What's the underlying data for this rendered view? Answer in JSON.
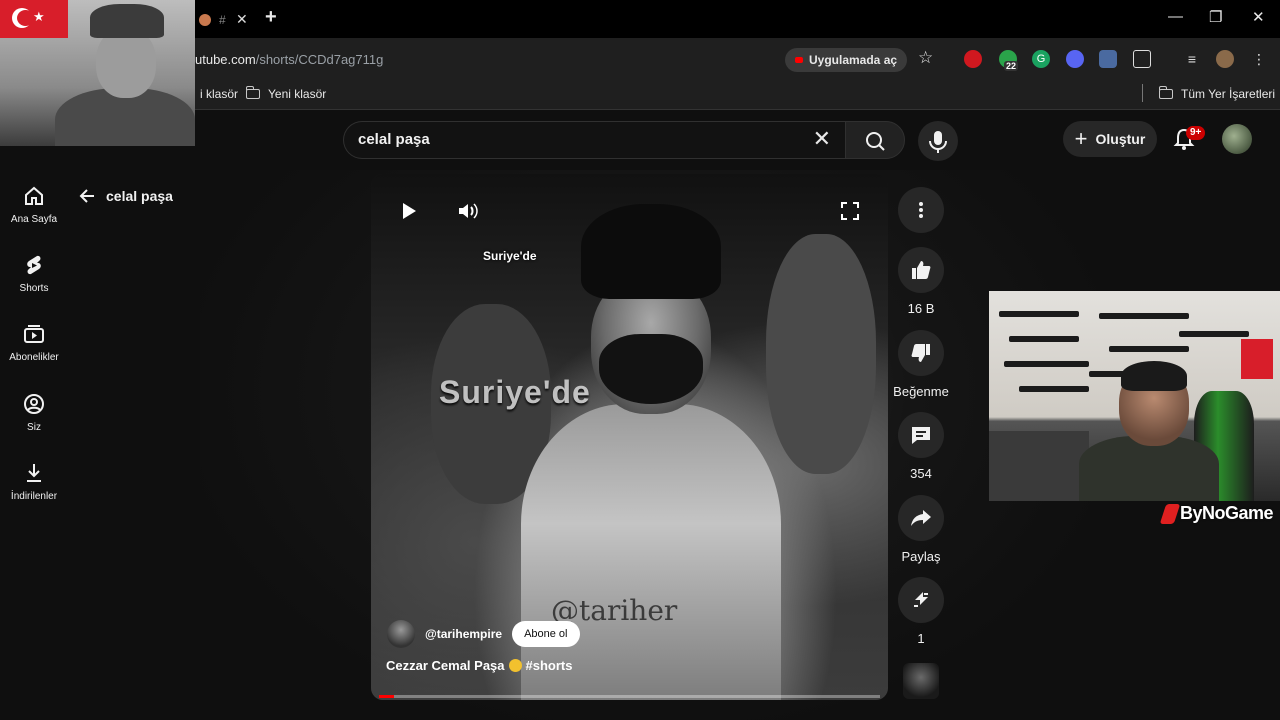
{
  "browser": {
    "tab_title": "#",
    "url_host": "utube.com",
    "url_path": "/shorts/CCDd7ag711g",
    "open_in_app": "Uygulamada aç",
    "extension_badge": "22",
    "bookmarks": [
      {
        "label": "i klasör"
      },
      {
        "label": "Yeni klasör"
      }
    ],
    "all_bookmarks": "Tüm Yer İşaretleri"
  },
  "header": {
    "search_value": "celal paşa",
    "create_label": "Oluştur",
    "notifications_badge": "9+"
  },
  "sidebar": {
    "items": [
      {
        "label": "Ana Sayfa",
        "icon": "home-icon"
      },
      {
        "label": "Shorts",
        "icon": "shorts-icon"
      },
      {
        "label": "Abonelikler",
        "icon": "subscriptions-icon"
      },
      {
        "label": "Siz",
        "icon": "you-icon"
      },
      {
        "label": "İndirilenler",
        "icon": "downloads-icon"
      }
    ],
    "back_label": "celal paşa"
  },
  "player": {
    "caption_small": "Suriye'de",
    "caption_big": "Suriye'de",
    "watermark": "@tariher",
    "channel": "@tarihempire",
    "subscribe_label": "Abone ol",
    "title_prefix": "Cezzar Cemal Paşa",
    "title_tag": "#shorts",
    "progress": 0.03
  },
  "actions": {
    "likes": "16 B",
    "dislike_label": "Beğenme",
    "comments": "354",
    "share_label": "Paylaş",
    "remix_count": "1"
  },
  "stream_overlay": {
    "brand": "ByNoGame"
  },
  "colors": {
    "accent": "#ff0000",
    "background": "#0f0f0f"
  }
}
